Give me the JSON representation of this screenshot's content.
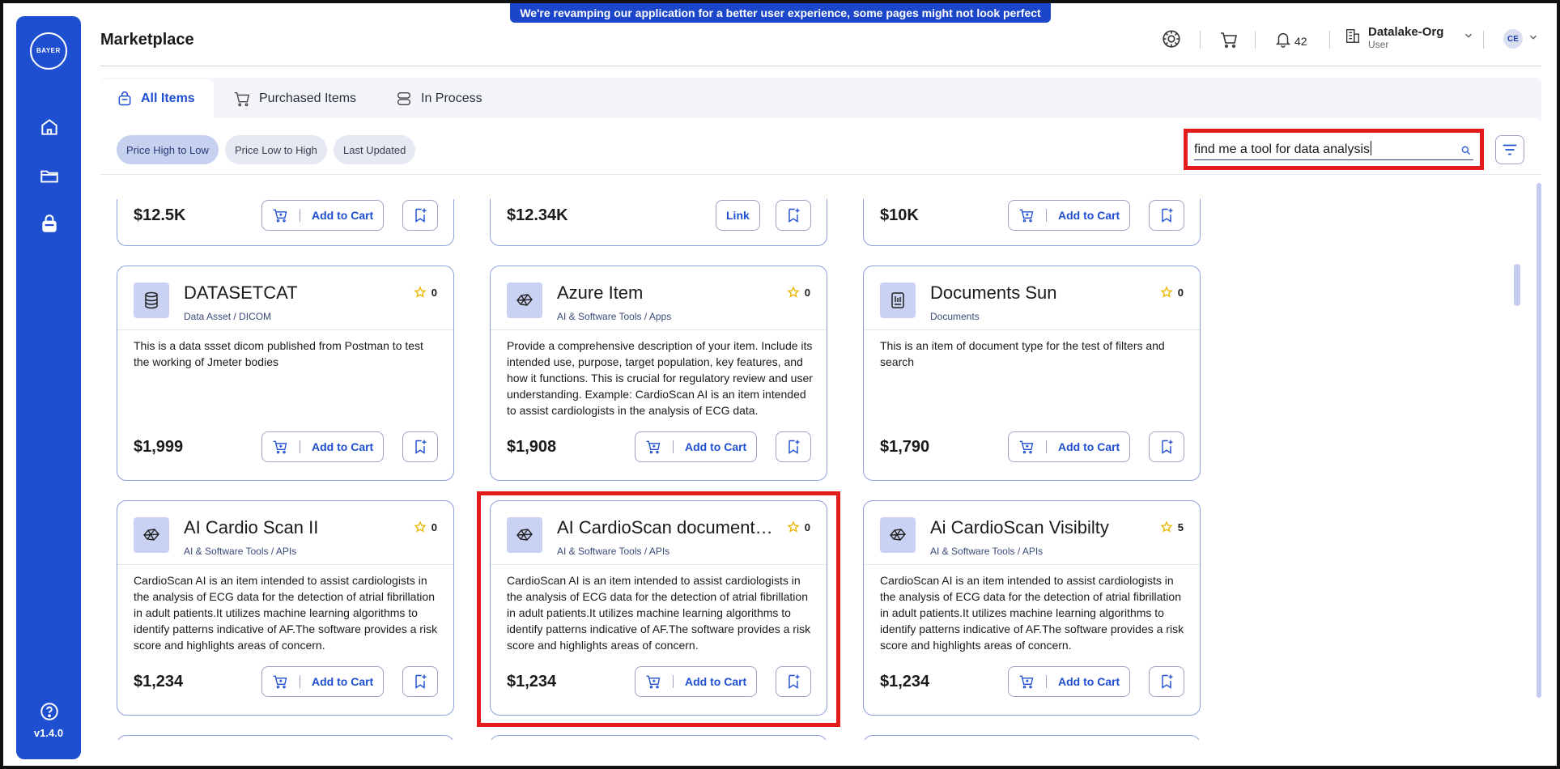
{
  "banner": "We're revamping our application for a better user experience, some pages might not look perfect yet!",
  "sidebar": {
    "logo_horizontal": "BAYER",
    "logo_vertical": "BAYER",
    "version": "v1.4.0"
  },
  "header": {
    "title": "Marketplace",
    "notification_count": "42",
    "org_name": "Datalake-Org",
    "org_role": "User",
    "avatar_initials": "CE"
  },
  "tabs": [
    {
      "label": "All Items"
    },
    {
      "label": "Purchased Items"
    },
    {
      "label": "In Process"
    }
  ],
  "sort_chips": [
    {
      "label": "Price High to Low"
    },
    {
      "label": "Price Low to High"
    },
    {
      "label": "Last Updated"
    }
  ],
  "search": {
    "value": "find me a tool for data analysis"
  },
  "add_to_cart_label": "Add to Cart",
  "link_label": "Link",
  "top_row_prices": [
    "$12.5K",
    "$12.34K",
    "$10K"
  ],
  "cards": [
    {
      "title": "DATASETCAT",
      "category": "Data Asset / DICOM",
      "rating": "0",
      "description": "This is a data ssset dicom published from Postman to test the working of Jmeter bodies",
      "price": "$1,999"
    },
    {
      "title": "Azure Item",
      "category": "AI & Software Tools / Apps",
      "rating": "0",
      "description": "Provide a comprehensive description of your item. Include its intended use, purpose, target population, key features, and how it functions. This is crucial for regulatory review and user understanding. Example: CardioScan AI is an item intended to assist cardiologists in the analysis of ECG data.",
      "price": "$1,908"
    },
    {
      "title": "Documents Sun",
      "category": "Documents",
      "rating": "0",
      "description": "This is an item of document type for the test of filters and search",
      "price": "$1,790"
    },
    {
      "title": "AI Cardio Scan II",
      "category": "AI & Software Tools / APIs",
      "rating": "0",
      "description": "CardioScan AI is an item intended to assist cardiologists in the analysis of ECG data for the detection of atrial fibrillation in adult patients.It utilizes machine learning algorithms to identify patterns indicative of AF.The software provides a risk score and highlights areas of concern.",
      "price": "$1,234"
    },
    {
      "title": "AI CardioScan documentation",
      "category": "AI & Software Tools / APIs",
      "rating": "0",
      "description": "CardioScan AI is an item intended to assist cardiologists in the analysis of ECG data for the detection of atrial fibrillation in adult patients.It utilizes machine learning algorithms to identify patterns indicative of AF.The software provides a risk score and highlights areas of concern.",
      "price": "$1,234"
    },
    {
      "title": "Ai CardioScan Visibilty",
      "category": "AI & Software Tools / APIs",
      "rating": "5",
      "description": "CardioScan AI is an item intended to assist cardiologists in the analysis of ECG data for the detection of atrial fibrillation in adult patients.It utilizes machine learning algorithms to identify patterns indicative of AF.The software provides a risk score and highlights areas of concern.",
      "price": "$1,234"
    }
  ],
  "colors": {
    "primary": "#1f4fd1",
    "highlight_red": "#e21b1b",
    "star": "#e8b400"
  }
}
